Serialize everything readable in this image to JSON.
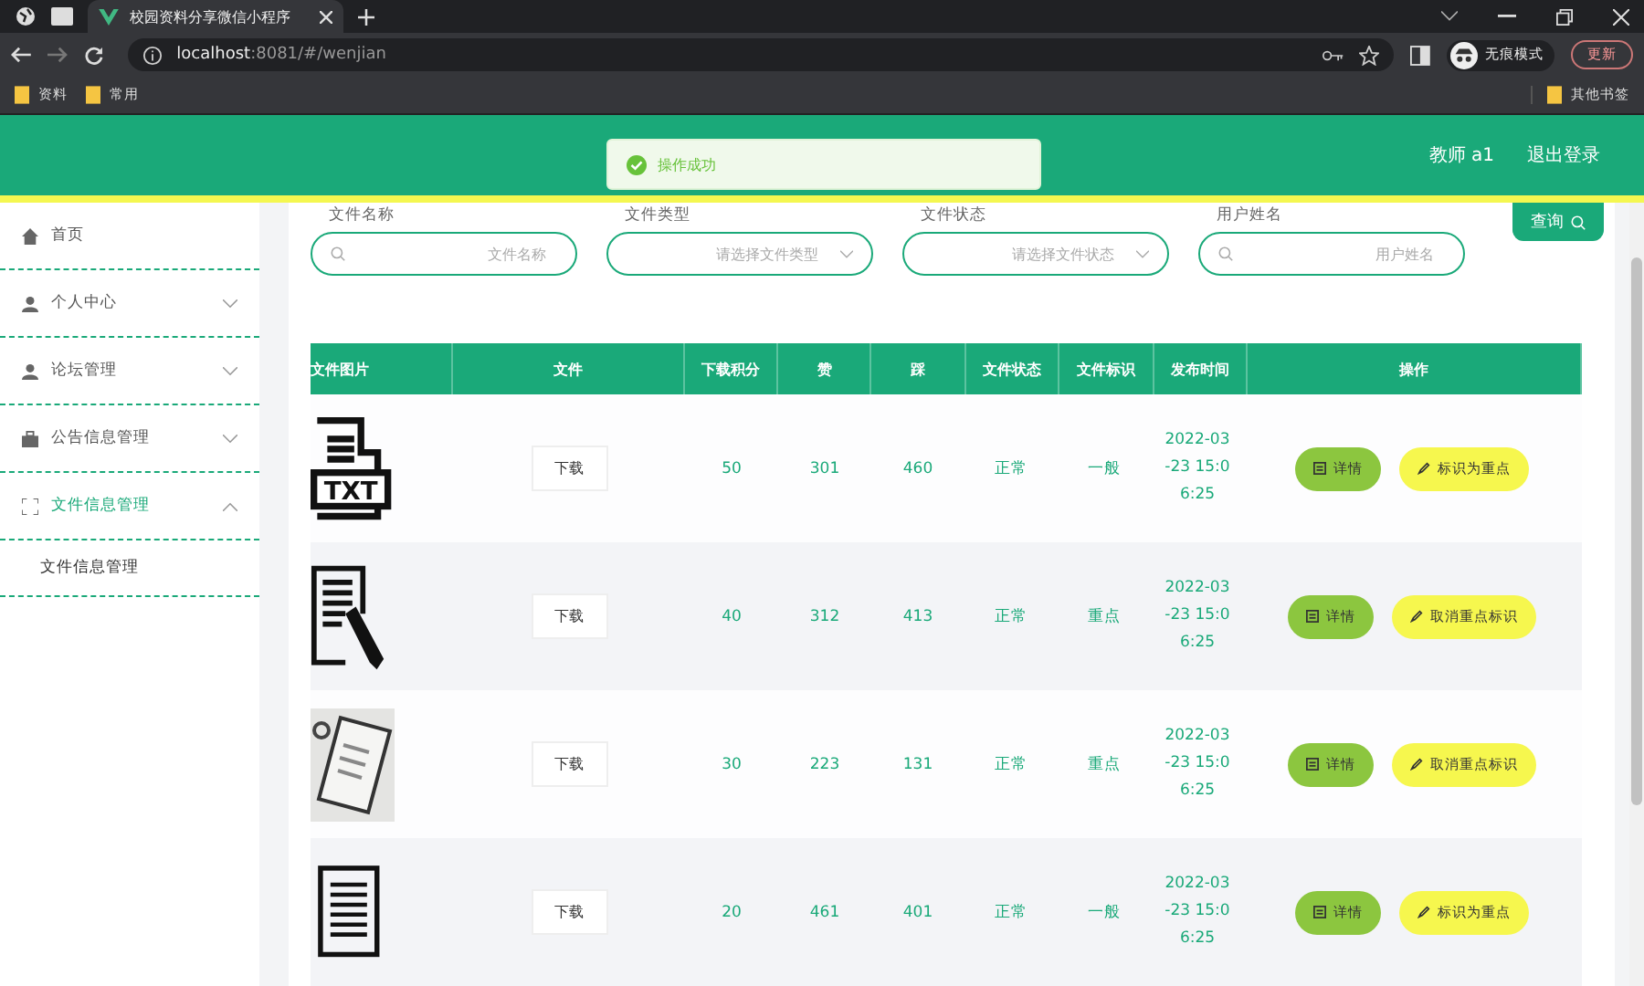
{
  "browser": {
    "tab_title": "校园资料分享微信小程序",
    "url_host": "localhost",
    "url_path": ":8081/#/wenjian",
    "profile": "无痕模式",
    "update": "更新",
    "bookmarks": [
      "资料",
      "常用"
    ],
    "other_bookmarks": "其他书签"
  },
  "header": {
    "user": "教师 a1",
    "logout": "退出登录"
  },
  "toast": {
    "message": "操作成功"
  },
  "sidebar": {
    "items": [
      {
        "label": "首页",
        "kind": "link",
        "expanded": false
      },
      {
        "label": "个人中心",
        "kind": "menu",
        "expanded": false
      },
      {
        "label": "论坛管理",
        "kind": "menu",
        "expanded": false
      },
      {
        "label": "公告信息管理",
        "kind": "menu",
        "expanded": false
      },
      {
        "label": "文件信息管理",
        "kind": "menu",
        "expanded": true,
        "children": [
          {
            "label": "文件信息管理"
          }
        ]
      }
    ]
  },
  "filters": [
    {
      "label": "文件名称",
      "placeholder": "文件名称",
      "kind": "search"
    },
    {
      "label": "文件类型",
      "placeholder": "请选择文件类型",
      "kind": "select"
    },
    {
      "label": "文件状态",
      "placeholder": "请选择文件状态",
      "kind": "select"
    },
    {
      "label": "用户姓名",
      "placeholder": "用户姓名",
      "kind": "search"
    }
  ],
  "query_button": "查询",
  "table": {
    "columns": [
      "文件图片",
      "文件",
      "下载积分",
      "赞",
      "踩",
      "文件状态",
      "文件标识",
      "发布时间",
      "操作"
    ],
    "rows": [
      {
        "image_label": "TXT",
        "file": "下载",
        "points": "50",
        "likes": "301",
        "dislikes": "460",
        "status": "正常",
        "mark": "一般",
        "time": "2022-03-23 15:06:25",
        "detail": "详情",
        "action": "标识为重点"
      },
      {
        "file": "下载",
        "points": "40",
        "likes": "312",
        "dislikes": "413",
        "status": "正常",
        "mark": "重点",
        "time": "2022-03-23 15:06:25",
        "detail": "详情",
        "action": "取消重点标识"
      },
      {
        "file": "下载",
        "points": "30",
        "likes": "223",
        "dislikes": "131",
        "status": "正常",
        "mark": "重点",
        "time": "2022-03-23 15:06:25",
        "detail": "详情",
        "action": "取消重点标识"
      },
      {
        "file": "下载",
        "points": "20",
        "likes": "461",
        "dislikes": "401",
        "status": "正常",
        "mark": "一般",
        "time": "2022-03-23 15:06:25",
        "detail": "详情",
        "action": "标识为重点"
      }
    ]
  }
}
